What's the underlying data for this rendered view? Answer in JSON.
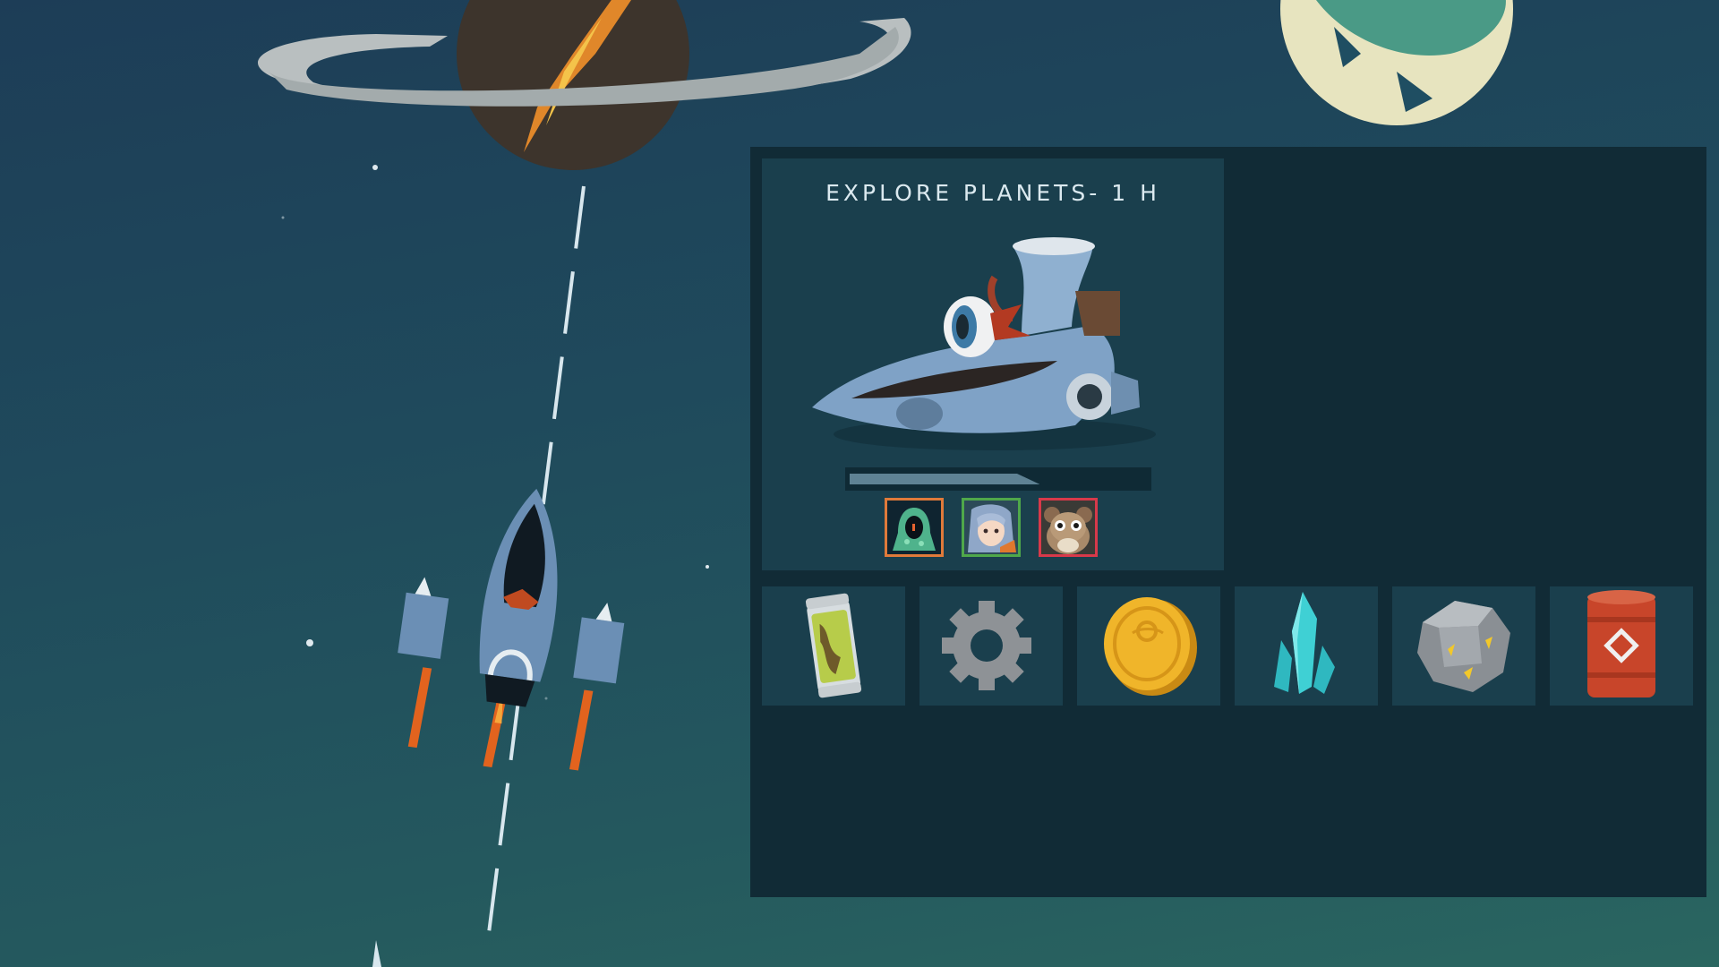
{
  "mission": {
    "title": "EXPLORE PLANETS- 1 H",
    "progress": 0.64
  },
  "crew": [
    {
      "name": "hooded-alien",
      "border": "#e07a3a"
    },
    {
      "name": "elf-girl",
      "border": "#4fa84a"
    },
    {
      "name": "tarsier",
      "border": "#d8394a"
    }
  ],
  "resources": [
    {
      "icon": "specimen-jar-icon"
    },
    {
      "icon": "gear-icon"
    },
    {
      "icon": "gold-coin-icon"
    },
    {
      "icon": "crystal-icon"
    },
    {
      "icon": "ore-rock-icon"
    },
    {
      "icon": "fuel-barrel-icon"
    }
  ],
  "colors": {
    "panel": "#112b36",
    "card": "#1a3f4d",
    "title": "#dbe9ef"
  }
}
